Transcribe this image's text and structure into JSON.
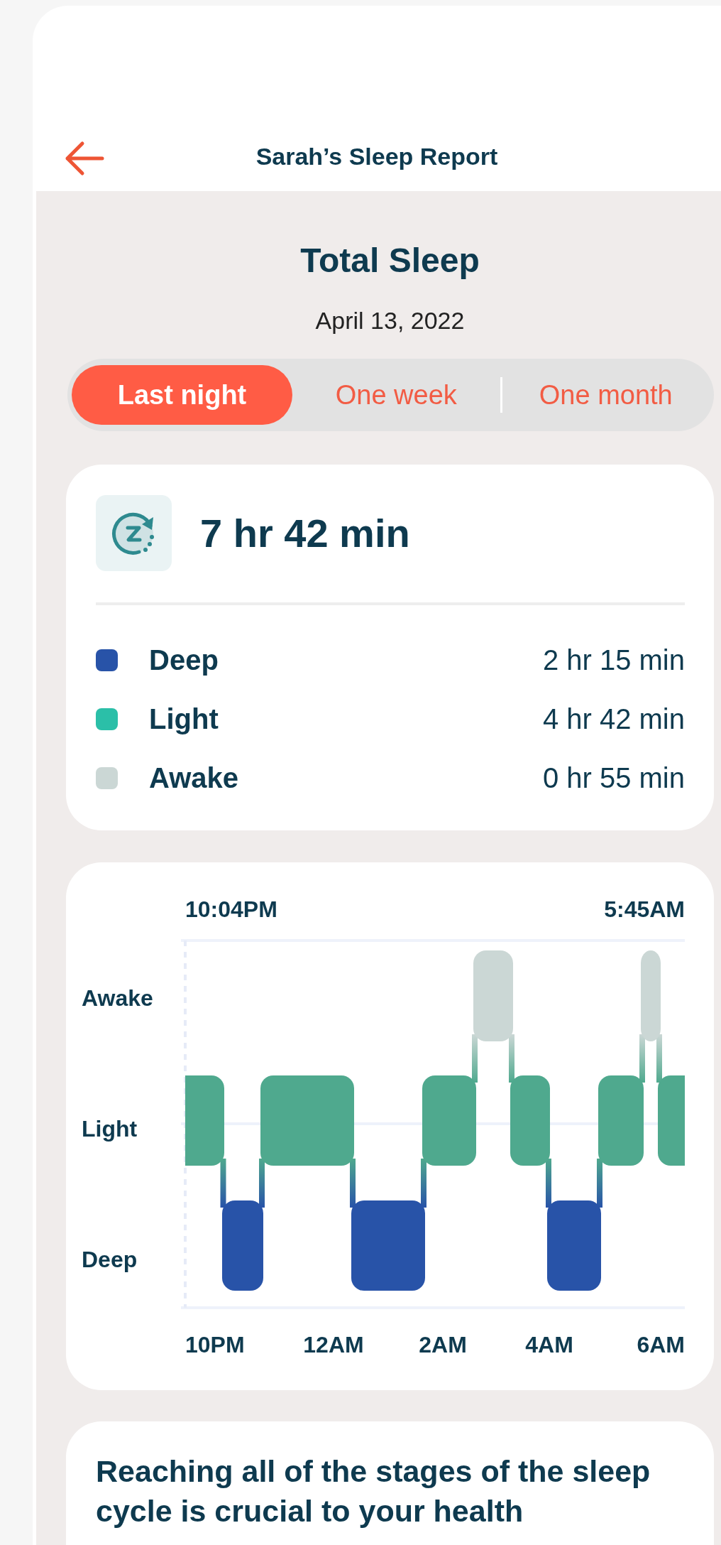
{
  "header": {
    "title": "Sarah’s Sleep Report"
  },
  "summary": {
    "title": "Total Sleep",
    "date": "April 13, 2022"
  },
  "tabs": [
    {
      "label": "Last night",
      "selected": true
    },
    {
      "label": "One week",
      "selected": false
    },
    {
      "label": "One month",
      "selected": false
    }
  ],
  "totals": {
    "total": "7 hr 42 min",
    "stages": [
      {
        "label": "Deep",
        "value": "2 hr 15 min",
        "color": "#2853a8"
      },
      {
        "label": "Light",
        "value": "4 hr 42 min",
        "color": "#2bbfa8"
      },
      {
        "label": "Awake",
        "value": "0 hr 55 min",
        "color": "#cbd7d5"
      }
    ]
  },
  "hypnogram": {
    "start_time": "10:04PM",
    "end_time": "5:45AM",
    "y_labels": [
      "Awake",
      "Light",
      "Deep"
    ],
    "x_labels": [
      "10PM",
      "12AM",
      "2AM",
      "4AM",
      "6AM"
    ]
  },
  "tip": {
    "text": "Reaching all of the stages of the sleep cycle is crucial to your health"
  }
}
